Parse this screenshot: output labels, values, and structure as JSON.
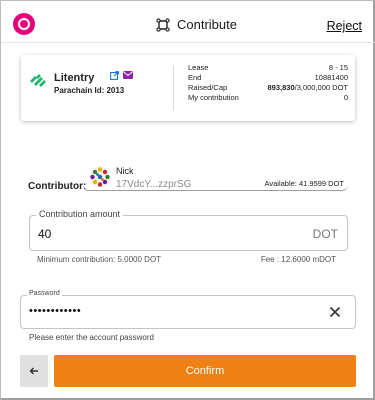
{
  "header": {
    "title": "Contribute",
    "reject_label": "Reject"
  },
  "crowdloan": {
    "chain_name": "Litentry",
    "parachain_id": "Parachain Id: 2013",
    "details": [
      {
        "label": "Lease",
        "value": "8 - 15"
      },
      {
        "label": "End",
        "value": "10881400"
      },
      {
        "label": "Raised/Cap",
        "value_bold": "893,830",
        "value_rest": "/3,000,000 DOT"
      },
      {
        "label": "My contribution",
        "value": "0"
      }
    ]
  },
  "contributor": {
    "label": "Contributor:",
    "account_name": "Nick",
    "address": "17VdcY...zzprSG",
    "available": "Available: 41.9599 DOT"
  },
  "amount": {
    "label": "Contribution amount",
    "value": "40",
    "unit": "DOT",
    "minimum": "Minimum contribution: 5.0000 DOT",
    "fee": "Fee : 12.6000 mDOT"
  },
  "password": {
    "label": "Password",
    "masked_value": "••••••••••••",
    "helper": "Please enter the account password"
  },
  "footer": {
    "back_icon": "arrow-left-icon",
    "confirm_label": "Confirm"
  },
  "colors": {
    "accent": "#ee8113",
    "brand": "#e6007a",
    "chain": "#22b573",
    "link": "#1976d2",
    "mail": "#8e24aa"
  }
}
